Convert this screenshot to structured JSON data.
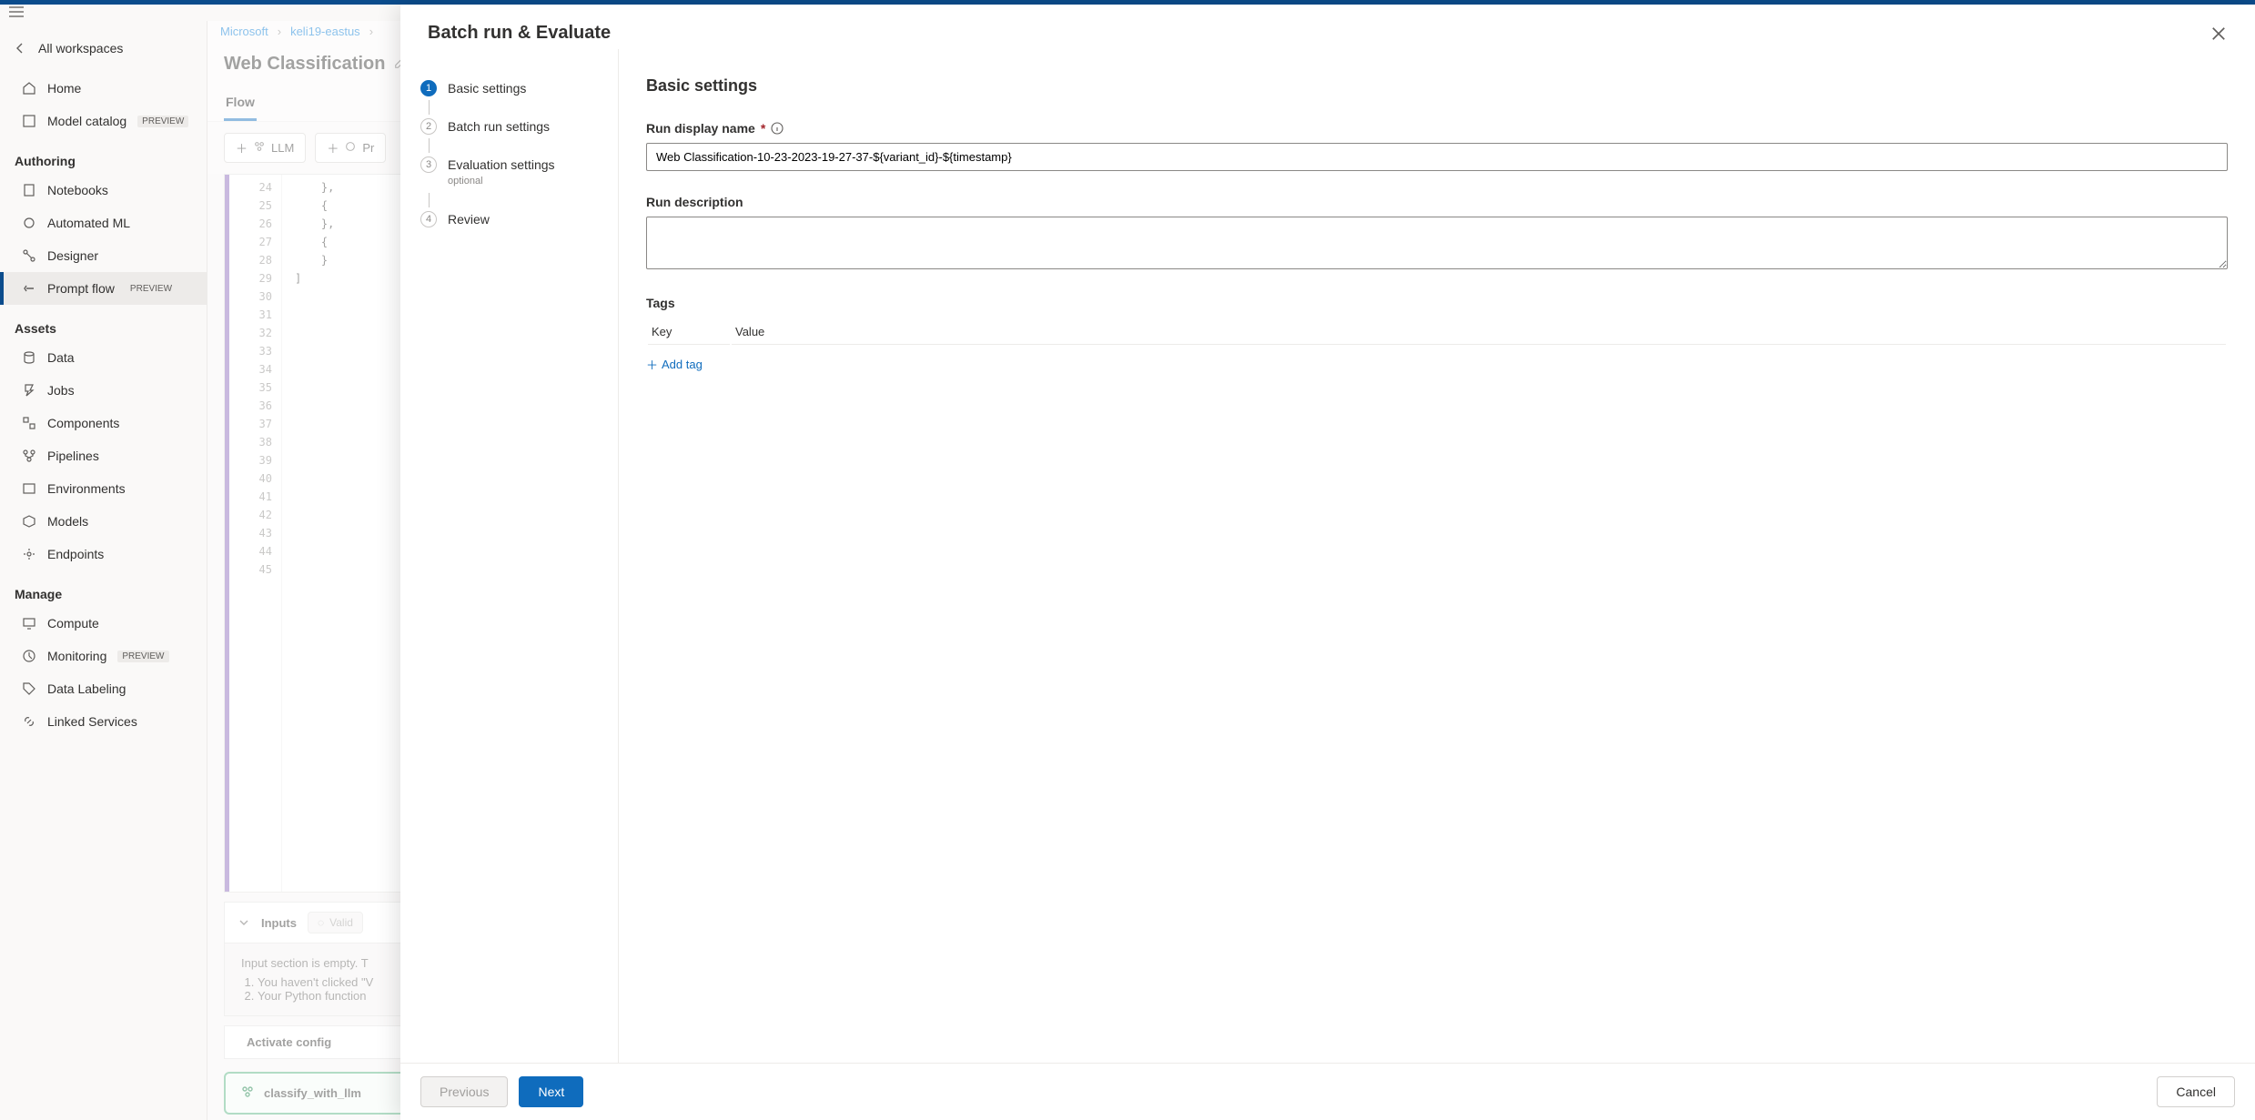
{
  "breadcrumb": {
    "org": "Microsoft",
    "workspace": "keli19-eastus"
  },
  "sidebar": {
    "back": "All workspaces",
    "home": "Home",
    "model_catalog": "Model catalog",
    "preview": "PREVIEW",
    "sections": {
      "authoring": "Authoring",
      "assets": "Assets",
      "manage": "Manage"
    },
    "notebooks": "Notebooks",
    "automl": "Automated ML",
    "designer": "Designer",
    "promptflow": "Prompt flow",
    "data": "Data",
    "jobs": "Jobs",
    "components": "Components",
    "pipelines": "Pipelines",
    "environments": "Environments",
    "models": "Models",
    "endpoints": "Endpoints",
    "compute": "Compute",
    "monitoring": "Monitoring",
    "datalabeling": "Data Labeling",
    "linked": "Linked Services"
  },
  "page": {
    "title": "Web Classification",
    "tab_flow": "Flow",
    "btn_llm": "LLM",
    "btn_pr": "Pr",
    "inputs_label": "Inputs",
    "valid_label": "Valid",
    "warn_line": "Input section is empty. T",
    "warn_1": "You haven't clicked \"V",
    "warn_2": "Your Python function",
    "activate": "Activate config",
    "classify": "classify_with_llm"
  },
  "editor": {
    "lines": [
      24,
      25,
      26,
      27,
      28,
      29,
      30,
      31,
      32,
      33,
      34,
      35,
      36,
      37,
      38,
      39,
      40,
      41,
      42,
      43,
      44,
      45
    ],
    "code_lines": [
      "",
      "",
      "    },",
      "    {",
      "",
      "",
      "",
      "",
      "",
      "",
      "",
      "",
      "",
      "    },",
      "    {",
      "",
      "",
      "",
      "",
      "    }",
      "]",
      ""
    ]
  },
  "modal": {
    "title": "Batch run & Evaluate",
    "steps": {
      "s1": "Basic settings",
      "s2": "Batch run settings",
      "s3": "Evaluation settings",
      "s3_sub": "optional",
      "s4": "Review"
    },
    "section_title": "Basic settings",
    "run_name_label": "Run display name",
    "run_name_value": "Web Classification-10-23-2023-19-27-37-${variant_id}-${timestamp}",
    "desc_label": "Run description",
    "tags_label": "Tags",
    "tags_key": "Key",
    "tags_value": "Value",
    "add_tag": "Add tag",
    "btn_prev": "Previous",
    "btn_next": "Next",
    "btn_cancel": "Cancel"
  }
}
